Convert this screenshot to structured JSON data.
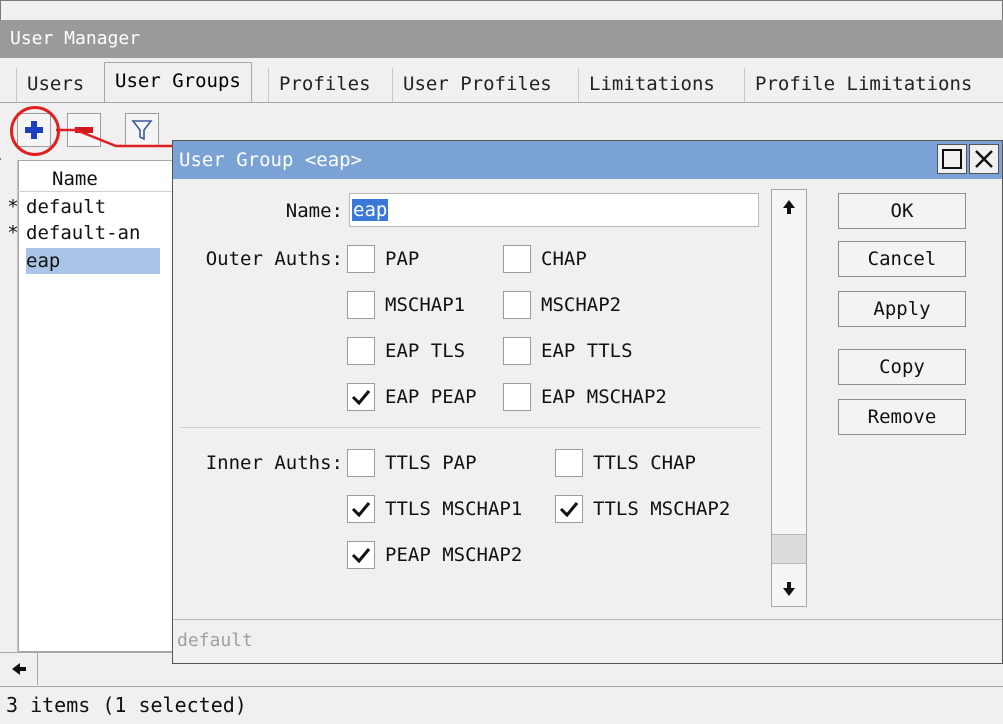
{
  "window": {
    "title": "User Manager"
  },
  "tabs": [
    "Users",
    "User Groups",
    "Profiles",
    "User Profiles",
    "Limitations",
    "Profile Limitations"
  ],
  "active_tab": "User Groups",
  "toolbar": {
    "add": "add-icon",
    "remove": "remove-icon",
    "filter": "filter-icon"
  },
  "list": {
    "header": "Name",
    "rows": [
      {
        "flag": "*",
        "name": "default-an",
        "label": "default"
      },
      {
        "flag": "*",
        "name": "default-an",
        "label": "default-an"
      },
      {
        "flag": "",
        "name": "eap",
        "label": "eap"
      }
    ]
  },
  "status": "3 items (1 selected)",
  "dialog": {
    "title": "User Group <eap>",
    "name_label": "Name:",
    "name_value": "eap",
    "outer_label": "Outer Auths:",
    "inner_label": "Inner Auths:",
    "outer": [
      {
        "label": "PAP",
        "checked": false
      },
      {
        "label": "CHAP",
        "checked": false
      },
      {
        "label": "MSCHAP1",
        "checked": false
      },
      {
        "label": "MSCHAP2",
        "checked": false
      },
      {
        "label": "EAP TLS",
        "checked": false
      },
      {
        "label": "EAP TTLS",
        "checked": false
      },
      {
        "label": "EAP PEAP",
        "checked": true
      },
      {
        "label": "EAP MSCHAP2",
        "checked": false
      }
    ],
    "inner": [
      {
        "label": "TTLS PAP",
        "checked": false
      },
      {
        "label": "TTLS CHAP",
        "checked": false
      },
      {
        "label": "TTLS MSCHAP1",
        "checked": true
      },
      {
        "label": "TTLS MSCHAP2",
        "checked": true
      },
      {
        "label": "PEAP MSCHAP2",
        "checked": true
      }
    ],
    "buttons": {
      "ok": "OK",
      "cancel": "Cancel",
      "apply": "Apply",
      "copy": "Copy",
      "remove": "Remove"
    },
    "status": "default"
  },
  "colors": {
    "titlebar": "#9a9a9a",
    "dialog_title": "#7ba2d4",
    "selection": "#a9c4e6",
    "annotation": "#e02020",
    "add": "#1a3fbf",
    "remove": "#d01818"
  }
}
